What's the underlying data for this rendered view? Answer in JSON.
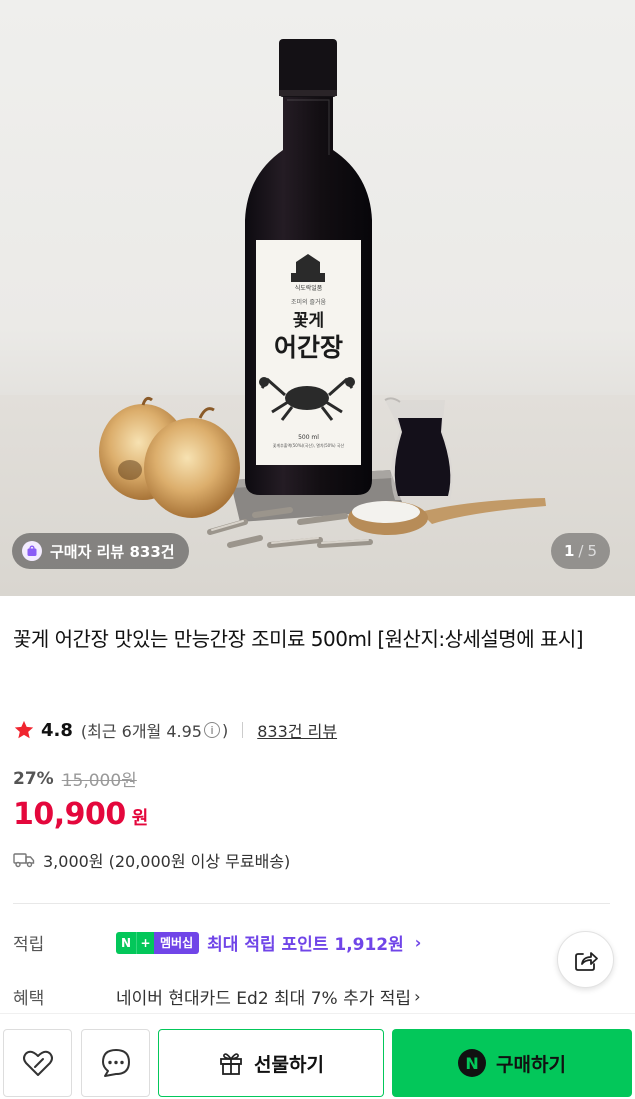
{
  "hero": {
    "bottle_label": {
      "brand": "식도락일품",
      "subtitle": "조미의 즐거움",
      "name_line1": "꽃게",
      "name_line2": "어간장",
      "volume": "500 ml",
      "ingredients": "꽃게추출액(50%)(국산), 멸치(50%) 국산"
    },
    "review_badge": "구매자 리뷰 833건",
    "pager": {
      "current": "1",
      "separator": "/",
      "total": "5"
    }
  },
  "product": {
    "title": "꽃게 어간장 맛있는 만능간장 조미료 500ml [원산지:상세설명에 표시]",
    "rating": {
      "score": "4.8",
      "recent_prefix": "(최근 6개월 4.95",
      "info_icon": "ⓘ",
      "recent_suffix": ")",
      "review_count": "833건 리뷰"
    },
    "discount_rate": "27%",
    "original_price": "15,000원",
    "price": "10,900",
    "currency": "원",
    "shipping": "3,000원 (20,000원 이상 무료배송)"
  },
  "benefits": {
    "points_label": "적립",
    "membership_badge": {
      "n": "N",
      "plus": "+",
      "text": "멤버십"
    },
    "points_text": "최대 적립 포인트 1,912원",
    "points_chevron": "›",
    "benefit_label": "혜택",
    "benefit_text": "네이버 현대카드 Ed2 최대 7% 추가 적립",
    "benefit_chevron": "›"
  },
  "bottom_bar": {
    "gift_label": "선물하기",
    "buy_logo": "N",
    "buy_label": "구매하기"
  },
  "colors": {
    "accent_red": "#e4073c",
    "naver_green": "#03c75a",
    "membership_purple": "#7045e8"
  },
  "icons": [
    "star-icon",
    "bag-icon",
    "truck-icon",
    "share-icon",
    "heart-icon",
    "chat-icon",
    "gift-icon",
    "naver-logo-icon"
  ]
}
